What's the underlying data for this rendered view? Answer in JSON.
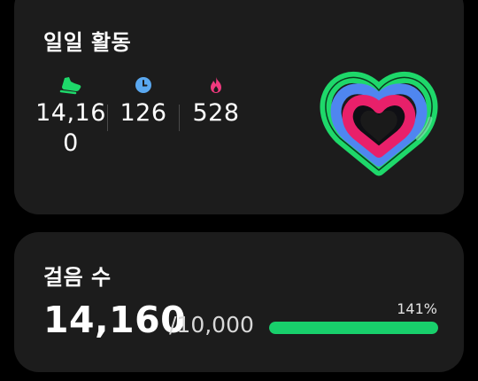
{
  "daily_activity": {
    "title": "일일 활동",
    "stats": {
      "steps": {
        "icon": "shoe-icon",
        "value": "14,160",
        "color": "#1ed86a"
      },
      "active_time": {
        "icon": "clock-icon",
        "value": "126",
        "color": "#5aa8f0"
      },
      "calories": {
        "icon": "flame-icon",
        "value": "528",
        "color": "#f0397e"
      }
    },
    "ring_colors": {
      "outer": "#1ed86a",
      "middle": "#4f86f0",
      "inner": "#e8206a"
    }
  },
  "steps_card": {
    "title": "걸음 수",
    "value": "14,160",
    "goal": "/10,000",
    "percent_label": "141%",
    "progress_fraction": 1.0,
    "bar_color": "#18cf6b"
  }
}
